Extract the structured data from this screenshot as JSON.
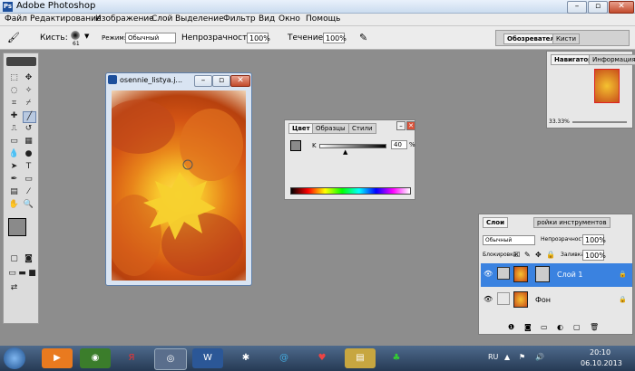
{
  "window": {
    "title": "Adobe Photoshop"
  },
  "menu": [
    "Файл",
    "Редактирование",
    "Изображение",
    "Слой",
    "Выделение",
    "Фильтр",
    "Вид",
    "Окно",
    "Помощь"
  ],
  "options": {
    "brush_label": "Кисть:",
    "brush_size": "61",
    "mode_label": "Режим:",
    "mode_value": "Обычный",
    "opacity_label": "Непрозрачность:",
    "opacity_value": "100%",
    "flow_label": "Течение:",
    "flow_value": "100%"
  },
  "palette_well": {
    "tab_browser": "Обозреватель",
    "tab_brushes": "Кисти"
  },
  "document": {
    "title": "osennie_listya.j..."
  },
  "navigator": {
    "tab_navigator": "Навигатор",
    "tab_info": "Информация",
    "zoom": "33.33%"
  },
  "color_panel": {
    "tab_color": "Цвет",
    "tab_swatches": "Образцы",
    "tab_styles": "Стили",
    "channel_label": "K",
    "value": "40",
    "unit": "%"
  },
  "layers": {
    "tab_layers": "Слои",
    "tab_other": "ройки инструментов",
    "blend_mode": "Обычный",
    "opacity_label": "Непрозрачность:",
    "opacity_value": "100%",
    "lock_label": "Блокировка:",
    "fill_label": "Заливка:",
    "fill_value": "100%",
    "items": [
      {
        "name": "Слой 1"
      },
      {
        "name": "Фон"
      }
    ]
  },
  "taskbar": {
    "lang": "RU",
    "time": "20:10",
    "date": "06.10.2013"
  },
  "colors": {
    "selection": "#3a82e0",
    "taskbar": "#263a54"
  }
}
